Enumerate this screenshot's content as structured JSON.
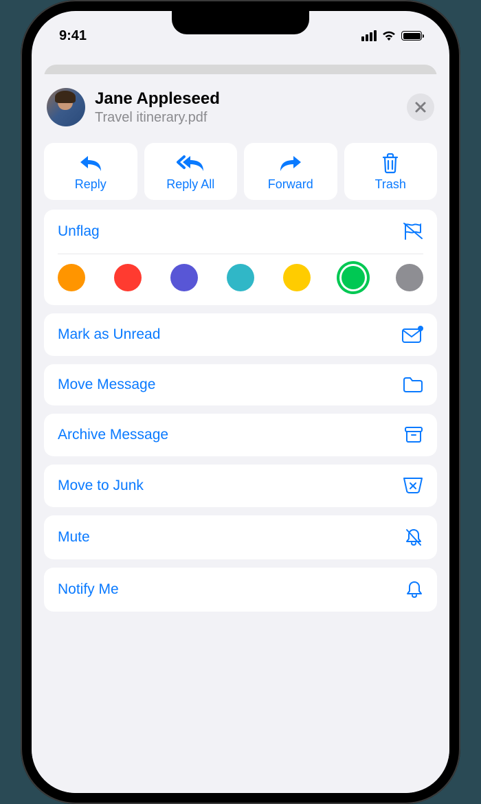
{
  "status": {
    "time": "9:41"
  },
  "header": {
    "sender": "Jane Appleseed",
    "subject": "Travel itinerary.pdf"
  },
  "actions": {
    "reply": "Reply",
    "reply_all": "Reply All",
    "forward": "Forward",
    "trash": "Trash"
  },
  "flag": {
    "unflag": "Unflag",
    "colors": {
      "orange": "#ff9500",
      "red": "#ff3b30",
      "purple": "#5856d6",
      "teal": "#30b7c7",
      "yellow": "#ffcc00",
      "green": "#00c853",
      "gray": "#8e8e93"
    },
    "selected": "green"
  },
  "menu": {
    "mark_unread": "Mark as Unread",
    "move": "Move Message",
    "archive": "Archive Message",
    "junk": "Move to Junk",
    "mute": "Mute",
    "notify": "Notify Me"
  }
}
